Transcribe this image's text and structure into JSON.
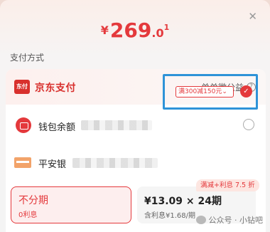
{
  "payment": {
    "currency_symbol": "¥",
    "amount_integer": "269",
    "amount_decimal": ".0",
    "amount_decimal2": "1",
    "close_icon": "close-icon"
  },
  "section_label": "支付方式",
  "jd_pay": {
    "logo_text": "东付",
    "name": "京东支付",
    "charity_label": "单单微公益",
    "help_icon_text": "?"
  },
  "wallet": {
    "label": "钱包余额",
    "icon": "wallet-icon"
  },
  "bank": {
    "label": "平安银",
    "icon": "bank-card-icon",
    "promo_select": "满300减150元",
    "dropdown_icon": "⌄",
    "check_icon": "✓"
  },
  "plans": {
    "no_install_title": "不分期",
    "no_install_sub": "0利息",
    "install_title": "¥13.09 × 24期",
    "install_sub": "含利息¥1.68/期",
    "install_tag": "满减+利息 7.5 折"
  },
  "watermark": {
    "text": "公众号 · 小钻吧"
  },
  "colors": {
    "accent": "#e4393c",
    "highlight_box": "#2f93d8"
  }
}
